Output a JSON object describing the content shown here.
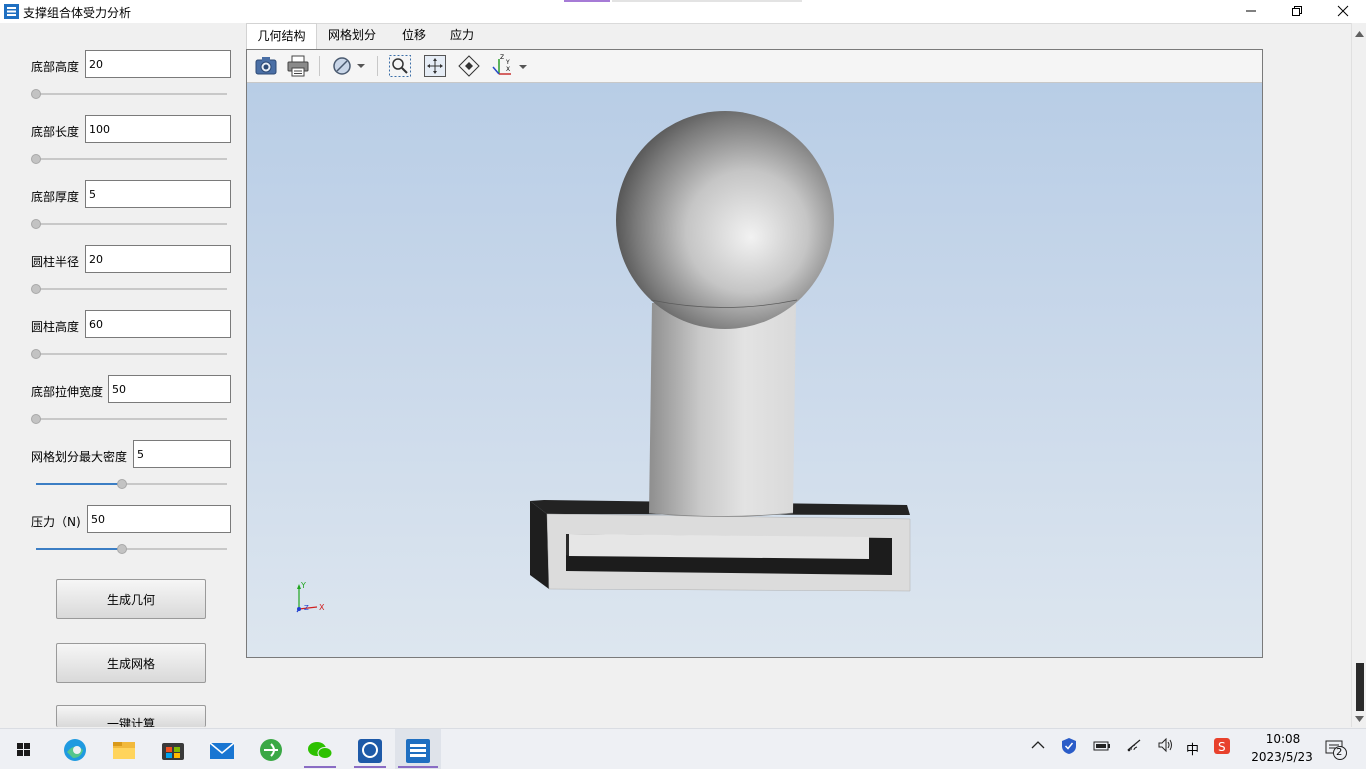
{
  "window": {
    "title": "支撑组合体受力分析"
  },
  "params": [
    {
      "label": "底部高度",
      "value": "20",
      "slider": 0.0
    },
    {
      "label": "底部长度",
      "value": "100",
      "slider": 0.0
    },
    {
      "label": "底部厚度",
      "value": "5",
      "slider": 0.0
    },
    {
      "label": "圆柱半径",
      "value": "20",
      "slider": 0.0
    },
    {
      "label": "圆柱高度",
      "value": "60",
      "slider": 0.0
    },
    {
      "label": "底部拉伸宽度",
      "value": "50",
      "slider": 0.0
    },
    {
      "label": "网格划分最大密度",
      "value": "5",
      "slider": 0.45
    },
    {
      "label": "压力（N)",
      "value": "50",
      "slider": 0.45
    }
  ],
  "buttons": {
    "geometry": "生成几何",
    "mesh": "生成网格",
    "compute": "一键计算"
  },
  "tabs": [
    "几何结构",
    "网格划分",
    "位移",
    "应力"
  ],
  "active_tab": 0,
  "toolbar_icons": [
    "camera-icon",
    "print-icon",
    "display-mode-icon",
    "zoom-window-icon",
    "fit-all-icon",
    "view-cube-icon",
    "axis-view-icon"
  ],
  "axis_triad": {
    "x": "X",
    "y": "Y",
    "z": "Z"
  },
  "taskbar": {
    "apps": [
      "edge-icon",
      "file-explorer-icon",
      "microsoft-store-icon",
      "mail-icon",
      "browser-icon",
      "wechat-icon",
      "app-icon",
      "current-app-icon"
    ],
    "ime": "中",
    "time": "10:08",
    "date": "2023/5/23",
    "notifications": "2"
  },
  "colors": {
    "accent": "#3c7ec4",
    "viewport_top": "#b8cde6",
    "viewport_bottom": "#dde6ef",
    "active_tab": "#ffffff"
  }
}
